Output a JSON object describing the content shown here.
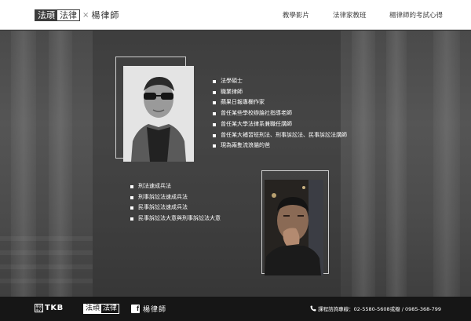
{
  "header": {
    "logo": {
      "part1": "法頑",
      "part2": "法律",
      "separator": "×",
      "name": "楊律師"
    },
    "nav": [
      {
        "label": "教學影片"
      },
      {
        "label": "法律家教班"
      },
      {
        "label": "楊律師的考試心得"
      }
    ]
  },
  "profile": {
    "credentials": [
      "法學碩士",
      "職業律師",
      "蘋果日報專欄作家",
      "曾任某些學校辯論社指導老師",
      "曾任某大學法律系兼職任講師",
      "曾任某大補習班刑法、刑事訴訟法、民事訴訟法講師",
      "現為兩隻流浪貓的爸"
    ],
    "courses": [
      "刑法速成兵法",
      "刑事訴訟法速成兵法",
      "民事訴訟法速成兵法",
      "民事訴訟法大意與刑事訴訟法大意"
    ]
  },
  "footer": {
    "tkb": {
      "seal": "學習 中心",
      "text": "TKB"
    },
    "logo": {
      "part1": "法頑",
      "part2": "法律"
    },
    "facebook": {
      "icon": "facebook-icon",
      "name": "楊律師"
    },
    "contact": {
      "icon": "phone-icon",
      "text": "課程諮詢專線：02-5580-5608或撥 / 0985-368-799"
    }
  },
  "colors": {
    "header_bg": "#ffffff",
    "hero_bg": "#4a4a4a",
    "footer_bg": "#161616",
    "text_light": "#ffffff"
  }
}
